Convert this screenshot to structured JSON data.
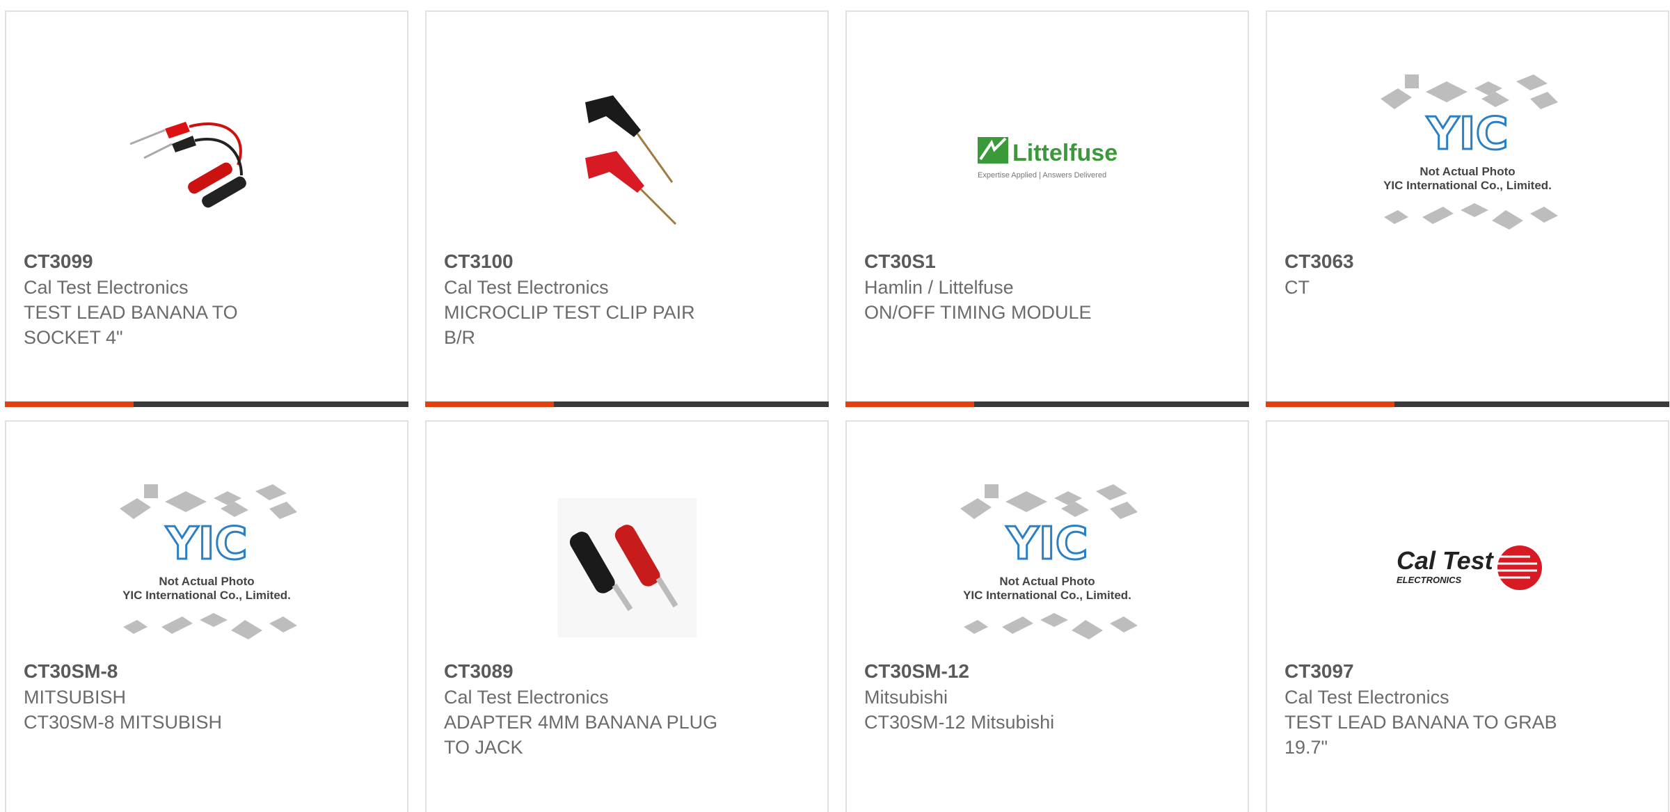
{
  "products": [
    {
      "part": "CT3099",
      "manufacturer": "Cal Test Electronics",
      "description": "TEST LEAD BANANA TO SOCKET 4\"",
      "image": "test-lead-photo"
    },
    {
      "part": "CT3100",
      "manufacturer": "Cal Test Electronics",
      "description": "MICROCLIP TEST CLIP PAIR B/R",
      "image": "microclip-photo"
    },
    {
      "part": "CT30S1",
      "manufacturer": "Hamlin / Littelfuse",
      "description": "ON/OFF TIMING MODULE",
      "image": "littelfuse-logo"
    },
    {
      "part": "CT3063",
      "manufacturer": "CT",
      "description": "",
      "image": "yic-placeholder"
    },
    {
      "part": "CT30SM-8",
      "manufacturer": "MITSUBISH",
      "description": "CT30SM-8 MITSUBISH",
      "image": "yic-placeholder"
    },
    {
      "part": "CT3089",
      "manufacturer": "Cal Test Electronics",
      "description": "ADAPTER 4MM BANANA PLUG TO JACK",
      "image": "banana-plug-photo"
    },
    {
      "part": "CT30SM-12",
      "manufacturer": "Mitsubishi",
      "description": "CT30SM-12 Mitsubishi",
      "image": "yic-placeholder"
    },
    {
      "part": "CT3097",
      "manufacturer": "Cal Test Electronics",
      "description": "TEST LEAD BANANA TO GRAB 19.7\"",
      "image": "caltest-logo"
    }
  ],
  "logos": {
    "littelfuse": {
      "name": "Littelfuse",
      "tagline": "Expertise Applied | Answers Delivered"
    },
    "yic": {
      "mark": "YIC",
      "line1": "Not Actual Photo",
      "line2": "YIC International Co., Limited."
    },
    "caltest": {
      "name": "Cal Test",
      "sub": "ELECTRONICS"
    }
  },
  "colors": {
    "accent": "#e2400f",
    "bar": "#3a3a3a",
    "border": "#e1e1e1",
    "text": "#6b6b6b"
  }
}
